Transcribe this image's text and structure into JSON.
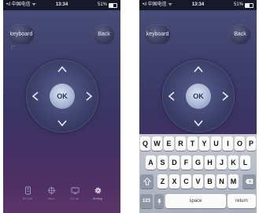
{
  "status_bar": {
    "carrier": "•ıl 中国电信 ᯤ",
    "time": "13:34",
    "battery": "51%"
  },
  "remote": {
    "keyboard_label": "keyboard",
    "back_label": "Back",
    "ok_label": "OK"
  },
  "bottom_tabs": [
    {
      "label": "IR Cntl",
      "icon": "remote-icon"
    },
    {
      "label": "Mou",
      "icon": "mouse-icon"
    },
    {
      "label": "EZ Air",
      "icon": "screen-icon"
    },
    {
      "label": "Setting",
      "icon": "gear-icon"
    }
  ],
  "keyboard": {
    "row1": [
      "Q",
      "W",
      "E",
      "R",
      "T",
      "Y",
      "U",
      "I",
      "O",
      "P"
    ],
    "row2": [
      "A",
      "S",
      "D",
      "F",
      "G",
      "H",
      "J",
      "K",
      "L"
    ],
    "row3": [
      "Z",
      "X",
      "C",
      "V",
      "B",
      "N",
      "M"
    ],
    "numbers_key": "123",
    "space_key": "space",
    "return_key": "return"
  },
  "colors": {
    "background_top": "#4b4f7a",
    "background_bottom": "#5b3468",
    "ok_button": "#a9b8d4",
    "keyboard_bg": "#b8bdc8"
  }
}
